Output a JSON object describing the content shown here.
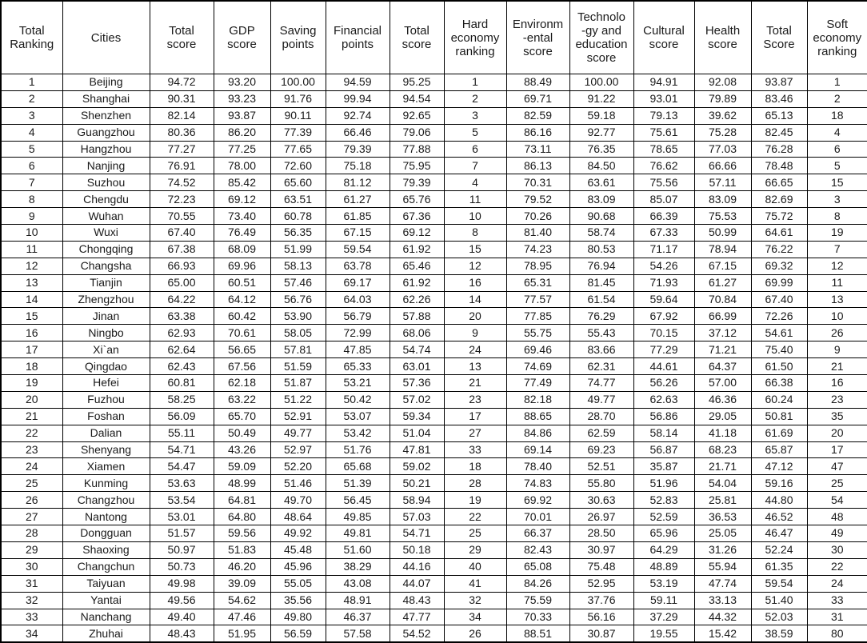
{
  "table": {
    "columns": [
      "Total\nRanking",
      "Cities",
      "Total\nscore",
      "GDP\nscore",
      "Saving\npoints",
      "Financial\npoints",
      "Total\nscore",
      "Hard\neconomy\nranking",
      "Environm\n-ental\nscore",
      "Technolo\n-gy and\neducation\nscore",
      "Cultural\nscore",
      "Health\nscore",
      "Total\nScore",
      "Soft\neconomy\nranking"
    ],
    "rows": [
      [
        "1",
        "Beijing",
        "94.72",
        "93.20",
        "100.00",
        "94.59",
        "95.25",
        "1",
        "88.49",
        "100.00",
        "94.91",
        "92.08",
        "93.87",
        "1"
      ],
      [
        "2",
        "Shanghai",
        "90.31",
        "93.23",
        "91.76",
        "99.94",
        "94.54",
        "2",
        "69.71",
        "91.22",
        "93.01",
        "79.89",
        "83.46",
        "2"
      ],
      [
        "3",
        "Shenzhen",
        "82.14",
        "93.87",
        "90.11",
        "92.74",
        "92.65",
        "3",
        "82.59",
        "59.18",
        "79.13",
        "39.62",
        "65.13",
        "18"
      ],
      [
        "4",
        "Guangzhou",
        "80.36",
        "86.20",
        "77.39",
        "66.46",
        "79.06",
        "5",
        "86.16",
        "92.77",
        "75.61",
        "75.28",
        "82.45",
        "4"
      ],
      [
        "5",
        "Hangzhou",
        "77.27",
        "77.25",
        "77.65",
        "79.39",
        "77.88",
        "6",
        "73.11",
        "76.35",
        "78.65",
        "77.03",
        "76.28",
        "6"
      ],
      [
        "6",
        "Nanjing",
        "76.91",
        "78.00",
        "72.60",
        "75.18",
        "75.95",
        "7",
        "86.13",
        "84.50",
        "76.62",
        "66.66",
        "78.48",
        "5"
      ],
      [
        "7",
        "Suzhou",
        "74.52",
        "85.42",
        "65.60",
        "81.12",
        "79.39",
        "4",
        "70.31",
        "63.61",
        "75.56",
        "57.11",
        "66.65",
        "15"
      ],
      [
        "8",
        "Chengdu",
        "72.23",
        "69.12",
        "63.51",
        "61.27",
        "65.76",
        "11",
        "79.52",
        "83.09",
        "85.07",
        "83.09",
        "82.69",
        "3"
      ],
      [
        "9",
        "Wuhan",
        "70.55",
        "73.40",
        "60.78",
        "61.85",
        "67.36",
        "10",
        "70.26",
        "90.68",
        "66.39",
        "75.53",
        "75.72",
        "8"
      ],
      [
        "10",
        "Wuxi",
        "67.40",
        "76.49",
        "56.35",
        "67.15",
        "69.12",
        "8",
        "81.40",
        "58.74",
        "67.33",
        "50.99",
        "64.61",
        "19"
      ],
      [
        "11",
        "Chongqing",
        "67.38",
        "68.09",
        "51.99",
        "59.54",
        "61.92",
        "15",
        "74.23",
        "80.53",
        "71.17",
        "78.94",
        "76.22",
        "7"
      ],
      [
        "12",
        "Changsha",
        "66.93",
        "69.96",
        "58.13",
        "63.78",
        "65.46",
        "12",
        "78.95",
        "76.94",
        "54.26",
        "67.15",
        "69.32",
        "12"
      ],
      [
        "13",
        "Tianjin",
        "65.00",
        "60.51",
        "57.46",
        "69.17",
        "61.92",
        "16",
        "65.31",
        "81.45",
        "71.93",
        "61.27",
        "69.99",
        "11"
      ],
      [
        "14",
        "Zhengzhou",
        "64.22",
        "64.12",
        "56.76",
        "64.03",
        "62.26",
        "14",
        "77.57",
        "61.54",
        "59.64",
        "70.84",
        "67.40",
        "13"
      ],
      [
        "15",
        "Jinan",
        "63.38",
        "60.42",
        "53.90",
        "56.79",
        "57.88",
        "20",
        "77.85",
        "76.29",
        "67.92",
        "66.99",
        "72.26",
        "10"
      ],
      [
        "16",
        "Ningbo",
        "62.93",
        "70.61",
        "58.05",
        "72.99",
        "68.06",
        "9",
        "55.75",
        "55.43",
        "70.15",
        "37.12",
        "54.61",
        "26"
      ],
      [
        "17",
        "Xi`an",
        "62.64",
        "56.65",
        "57.81",
        "47.85",
        "54.74",
        "24",
        "69.46",
        "83.66",
        "77.29",
        "71.21",
        "75.40",
        "9"
      ],
      [
        "18",
        "Qingdao",
        "62.43",
        "67.56",
        "51.59",
        "65.33",
        "63.01",
        "13",
        "74.69",
        "62.31",
        "44.61",
        "64.37",
        "61.50",
        "21"
      ],
      [
        "19",
        "Hefei",
        "60.81",
        "62.18",
        "51.87",
        "53.21",
        "57.36",
        "21",
        "77.49",
        "74.77",
        "56.26",
        "57.00",
        "66.38",
        "16"
      ],
      [
        "20",
        "Fuzhou",
        "58.25",
        "63.22",
        "51.22",
        "50.42",
        "57.02",
        "23",
        "82.18",
        "49.77",
        "62.63",
        "46.36",
        "60.24",
        "23"
      ],
      [
        "21",
        "Foshan",
        "56.09",
        "65.70",
        "52.91",
        "53.07",
        "59.34",
        "17",
        "88.65",
        "28.70",
        "56.86",
        "29.05",
        "50.81",
        "35"
      ],
      [
        "22",
        "Dalian",
        "55.11",
        "50.49",
        "49.77",
        "53.42",
        "51.04",
        "27",
        "84.86",
        "62.59",
        "58.14",
        "41.18",
        "61.69",
        "20"
      ],
      [
        "23",
        "Shenyang",
        "54.71",
        "43.26",
        "52.97",
        "51.76",
        "47.81",
        "33",
        "69.14",
        "69.23",
        "56.87",
        "68.23",
        "65.87",
        "17"
      ],
      [
        "24",
        "Xiamen",
        "54.47",
        "59.09",
        "52.20",
        "65.68",
        "59.02",
        "18",
        "78.40",
        "52.51",
        "35.87",
        "21.71",
        "47.12",
        "47"
      ],
      [
        "25",
        "Kunming",
        "53.63",
        "48.99",
        "51.46",
        "51.39",
        "50.21",
        "28",
        "74.83",
        "55.80",
        "51.96",
        "54.04",
        "59.16",
        "25"
      ],
      [
        "26",
        "Changzhou",
        "53.54",
        "64.81",
        "49.70",
        "56.45",
        "58.94",
        "19",
        "69.92",
        "30.63",
        "52.83",
        "25.81",
        "44.80",
        "54"
      ],
      [
        "27",
        "Nantong",
        "53.01",
        "64.80",
        "48.64",
        "49.85",
        "57.03",
        "22",
        "70.01",
        "26.97",
        "52.59",
        "36.53",
        "46.52",
        "48"
      ],
      [
        "28",
        "Dongguan",
        "51.57",
        "59.56",
        "49.92",
        "49.81",
        "54.71",
        "25",
        "66.37",
        "28.50",
        "65.96",
        "25.05",
        "46.47",
        "49"
      ],
      [
        "29",
        "Shaoxing",
        "50.97",
        "51.83",
        "45.48",
        "51.60",
        "50.18",
        "29",
        "82.43",
        "30.97",
        "64.29",
        "31.26",
        "52.24",
        "30"
      ],
      [
        "30",
        "Changchun",
        "50.73",
        "46.20",
        "45.96",
        "38.29",
        "44.16",
        "40",
        "65.08",
        "75.48",
        "48.89",
        "55.94",
        "61.35",
        "22"
      ],
      [
        "31",
        "Taiyuan",
        "49.98",
        "39.09",
        "55.05",
        "43.08",
        "44.07",
        "41",
        "84.26",
        "52.95",
        "53.19",
        "47.74",
        "59.54",
        "24"
      ],
      [
        "32",
        "Yantai",
        "49.56",
        "54.62",
        "35.56",
        "48.91",
        "48.43",
        "32",
        "75.59",
        "37.76",
        "59.11",
        "33.13",
        "51.40",
        "33"
      ],
      [
        "33",
        "Nanchang",
        "49.40",
        "47.46",
        "49.80",
        "46.37",
        "47.77",
        "34",
        "70.33",
        "56.16",
        "37.29",
        "44.32",
        "52.03",
        "31"
      ],
      [
        "34",
        "Zhuhai",
        "48.43",
        "51.95",
        "56.59",
        "57.58",
        "54.52",
        "26",
        "88.51",
        "30.87",
        "19.55",
        "15.42",
        "38.59",
        "80"
      ]
    ]
  }
}
